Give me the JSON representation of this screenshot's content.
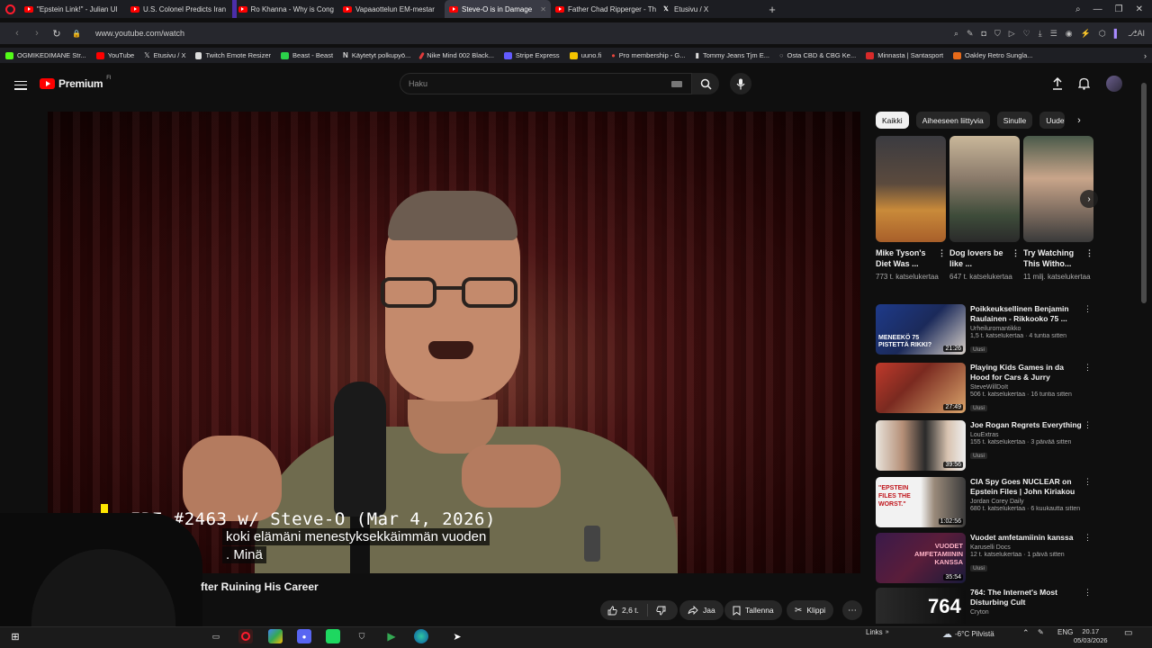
{
  "browser": {
    "tabs": [
      {
        "title": "\"Epstein Link!\" - Julian UI",
        "icon": "youtube-icon"
      },
      {
        "title": "U.S. Colonel Predicts Iran",
        "icon": "youtube-icon"
      },
      {
        "title": "Ro Khanna - Why is Cong",
        "icon": "youtube-icon"
      },
      {
        "title": "Vapaaottelun EM-mestar",
        "icon": "youtube-icon"
      },
      {
        "title": "Steve-O is in Damage",
        "icon": "youtube-icon",
        "active": true
      },
      {
        "title": "Father Chad Ripperger - Th",
        "icon": "youtube-icon"
      },
      {
        "title": "Etusivu / X",
        "icon": "x-icon"
      }
    ],
    "url": "www.youtube.com/watch",
    "bookmarks": [
      {
        "label": "OGMIKEDIMANE Str...",
        "color": "#53fc18"
      },
      {
        "label": "YouTube",
        "color": "#ff0000"
      },
      {
        "label": "Etusivu / X",
        "color": "#000000"
      },
      {
        "label": "Twitch Emote Resizer",
        "color": "#dddddd"
      },
      {
        "label": "Beast - Beast",
        "color": "#2bd14a"
      },
      {
        "label": "Käytetyt polkupyö...",
        "color": "#ffffff"
      },
      {
        "label": "Nike Mind 002 Black...",
        "color": "#e23b3b"
      },
      {
        "label": "Stripe Express",
        "color": "#635bff"
      },
      {
        "label": "uuno.fi",
        "color": "#f5c400"
      },
      {
        "label": "Pro membership - G...",
        "color": "#e8453c"
      },
      {
        "label": "Tommy Jeans Tjm E...",
        "color": "#ffffff"
      },
      {
        "label": "Osta CBD & CBG Ke...",
        "color": "#888888"
      },
      {
        "label": "Minnasta | Santasport",
        "color": "#d82a2a"
      },
      {
        "label": "Oakley Retro Sungla...",
        "color": "#e86b1a"
      }
    ]
  },
  "youtube": {
    "brand": "Premium",
    "region": "FI",
    "search_placeholder": "Haku",
    "video": {
      "overlay_title": "IRE #2463 w/ Steve-O (Mar 4, 2026)",
      "subtitles": [
        "koki elämäni menestyksekkäimmän vuoden",
        ". Minä"
      ],
      "title": "fter Ruining His Career",
      "actions": {
        "like_count": "2,6 t.",
        "share": "Jaa",
        "save": "Tallenna",
        "clip": "Klippi"
      }
    },
    "chips": [
      "Kaikki",
      "Aiheeseen liittyvia",
      "Sinulle",
      "Uudet"
    ],
    "shorts": [
      {
        "title": "Mike Tyson's Diet Was ...",
        "views": "773 t. katselukertaa"
      },
      {
        "title": "Dog lovers be like ...",
        "views": "647 t. katselukertaa"
      },
      {
        "title": "Try Watching This Witho...",
        "views": "11 milj. katselukertaa"
      }
    ],
    "recommendations": [
      {
        "title": "Poikkeuksellinen Benjamin Raulainen - Rikkooko 75 ...",
        "channel": "Urheiluromantikko",
        "meta": "1,5 t. katselukertaa · 4 tuntia sitten",
        "badge": "Uusi",
        "duration": "21:26",
        "thumb_text": "MENEEKÖ 75 PISTETTÄ RIKKI?"
      },
      {
        "title": "Playing Kids Games in da Hood for Cars & Jurry",
        "channel": "SteveWillDoIt",
        "meta": "506 t. katselukertaa · 16 tuntia sitten",
        "badge": "Uusi",
        "duration": "27:49",
        "thumb_text": ""
      },
      {
        "title": "Joe Rogan Regrets Everything",
        "channel": "LouExtras",
        "meta": "155 t. katselukertaa · 3 päivää sitten",
        "badge": "Uusi",
        "duration": "39:56",
        "thumb_text": ""
      },
      {
        "title": "CIA Spy Goes NUCLEAR on Epstein Files | John Kiriakou",
        "channel": "Jordan Corey Daily",
        "meta": "680 t. katselukertaa · 6 kuukautta sitten",
        "badge": "",
        "duration": "1:02:56",
        "thumb_text": "\"EPSTEIN FILES THE WORST.\""
      },
      {
        "title": "Vuodet amfetamiinin kanssa",
        "channel": "Karuselli Docs",
        "meta": "12 t. katselukertaa · 1 päivä sitten",
        "badge": "Uusi",
        "duration": "35:54",
        "thumb_text": "VUODET AMFETAMIININ KANSSA"
      },
      {
        "title": "764: The Internet's Most Disturbing Cult",
        "channel": "Cryton",
        "meta": "",
        "badge": "",
        "duration": "",
        "thumb_text": "764"
      }
    ]
  },
  "taskbar": {
    "links_label": "Links",
    "weather": "-6°C Pilvistä",
    "lang": "ENG",
    "time": "20.17",
    "date": "05/03/2026"
  }
}
